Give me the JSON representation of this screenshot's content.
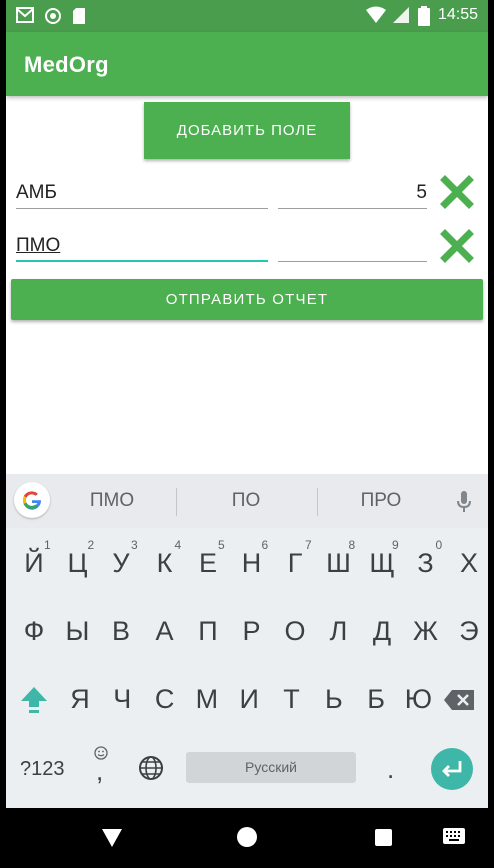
{
  "status_bar": {
    "time": "14:55"
  },
  "app_bar": {
    "title": "MedOrg"
  },
  "add_field_button": "ДОБАВИТЬ ПОЛЕ",
  "rows": [
    {
      "name": "АМБ",
      "value": "5"
    },
    {
      "name": "ПМО",
      "value": ""
    }
  ],
  "send_report_button": "ОТПРАВИТЬ ОТЧЕТ",
  "keyboard": {
    "suggestions": [
      "ПМО",
      "ПО",
      "ПРО"
    ],
    "row1": [
      "Й",
      "Ц",
      "У",
      "К",
      "Е",
      "Н",
      "Г",
      "Ш",
      "Щ",
      "З",
      "Х"
    ],
    "row1_hints": [
      "1",
      "2",
      "3",
      "4",
      "5",
      "6",
      "7",
      "8",
      "9",
      "0"
    ],
    "row2": [
      "Ф",
      "Ы",
      "В",
      "А",
      "П",
      "Р",
      "О",
      "Л",
      "Д",
      "Ж",
      "Э"
    ],
    "row3": [
      "Я",
      "Ч",
      "С",
      "М",
      "И",
      "Т",
      "Ь",
      "Б",
      "Ю"
    ],
    "symbols_key": "?123",
    "comma_key": ",",
    "space_label": "Русский",
    "period_key": "."
  },
  "colors": {
    "accent": "#4caf50",
    "status_bar": "#4a9d4d",
    "focus_line": "#26c6b0",
    "enter_key": "#3fb7a8"
  }
}
